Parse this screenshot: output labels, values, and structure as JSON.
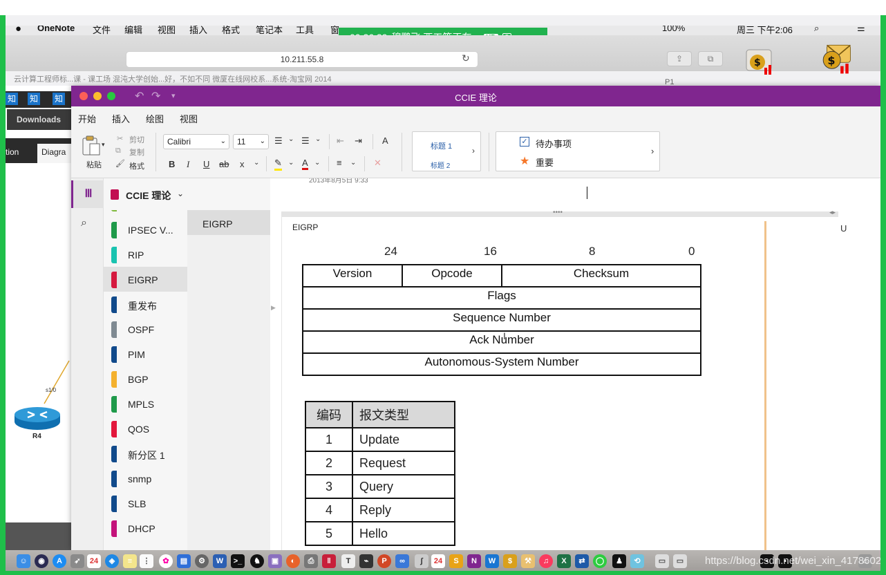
{
  "menubar": {
    "app": "OneNote",
    "items": [
      "文件",
      "编辑",
      "视图",
      "插入",
      "格式",
      "笔记本",
      "工具",
      "窗"
    ],
    "battery": "100%",
    "clock": "周三 下午2:06"
  },
  "live": {
    "timer": "00:26:29",
    "text": "穆鹏飞 西工等正在...",
    "hd": "HD",
    "people": "8"
  },
  "browser": {
    "url": "10.211.55.8",
    "bookmarks": "云计算工程师标...课 - 课工场    混沌大学创始...好，不如不同    微厦在线网校系...系统-淘宝网    2014",
    "p1": "P1"
  },
  "bgapp": {
    "zhi": [
      "知",
      "知",
      "知"
    ],
    "downloads": "Downloads",
    "tab1": "tion",
    "tab2": "Diagra",
    "router_label": "R4",
    "link_label": "s1/0"
  },
  "onenote": {
    "window_title": "CCIE 理论",
    "ribbon_tabs": [
      "开始",
      "插入",
      "绘图",
      "视图"
    ],
    "paste": "粘贴",
    "cut": "剪切",
    "copy": "复制",
    "format_painter": "格式",
    "font": "Calibri",
    "font_size": "11",
    "bold": "B",
    "italic": "I",
    "underline": "U",
    "strike": "ab",
    "subscript": "x",
    "styles": [
      "标题 1",
      "标题 2"
    ],
    "tags": [
      "待办事项",
      "重要"
    ],
    "notebook": "CCIE 理论",
    "sections": [
      {
        "label": "IPSEC V...",
        "color": "#1f9a4a"
      },
      {
        "label": "RIP",
        "color": "#19c3b0"
      },
      {
        "label": "EIGRP",
        "color": "#d5193f"
      },
      {
        "label": "重发布",
        "color": "#114a8b"
      },
      {
        "label": "OSPF",
        "color": "#7f8a92"
      },
      {
        "label": "PIM",
        "color": "#114a8b"
      },
      {
        "label": "BGP",
        "color": "#f4b12e"
      },
      {
        "label": "MPLS",
        "color": "#1f9a4a"
      },
      {
        "label": "QOS",
        "color": "#e3173c"
      },
      {
        "label": "新分区 1",
        "color": "#114a8b"
      },
      {
        "label": "snmp",
        "color": "#114a8b"
      },
      {
        "label": "SLB",
        "color": "#114a8b"
      },
      {
        "label": "DHCP",
        "color": "#c4137b"
      }
    ],
    "selected_section": "EIGRP",
    "page": "EIGRP",
    "page_datetime": "2013年8月5日      9:33",
    "container_title": "EIGRP",
    "right_char": "U"
  },
  "packet": {
    "bits": [
      "24",
      "16",
      "8",
      "0"
    ],
    "row1": [
      "Version",
      "Opcode",
      "Checksum"
    ],
    "rows": [
      "Flags",
      "Sequence Number",
      "Ack Number",
      "Autonomous-System Number"
    ]
  },
  "types_table": {
    "headers": [
      "编码",
      "报文类型"
    ],
    "rows": [
      [
        "1",
        "Update"
      ],
      [
        "2",
        "Request"
      ],
      [
        "3",
        "Query"
      ],
      [
        "4",
        "Reply"
      ],
      [
        "5",
        "Hello"
      ]
    ]
  },
  "dock": {
    "calendar_day": "24",
    "watermark": "https://blog.csdn.net/wei_xin_4178602"
  }
}
